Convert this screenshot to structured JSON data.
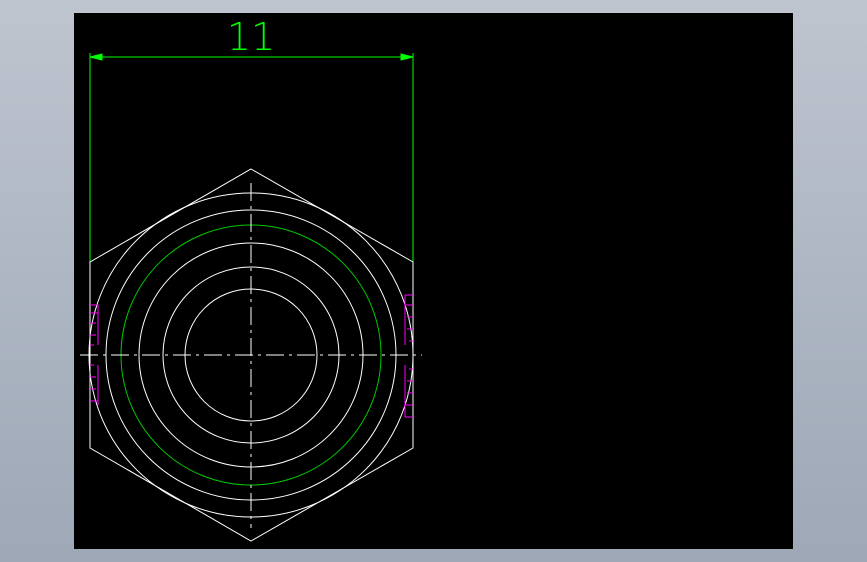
{
  "drawing": {
    "dimension_label": "11",
    "colors": {
      "background": "#000000",
      "outline": "#ffffff",
      "dimension": "#00ff00",
      "thread": "#00c800",
      "hatch": "#ff00ff"
    }
  }
}
